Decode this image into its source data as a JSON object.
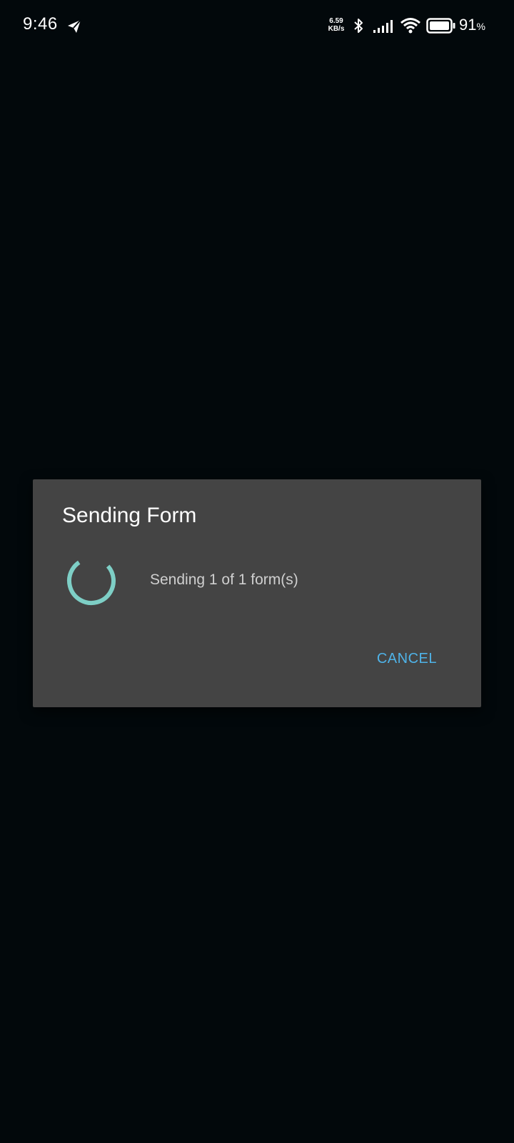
{
  "status_bar": {
    "time": "9:46",
    "net_speed_value": "6.59",
    "net_speed_unit": "KB/s",
    "battery_level": "91",
    "battery_unit": "%",
    "icons": [
      "telegram-icon",
      "bluetooth-icon",
      "signal-icon",
      "wifi-icon",
      "battery-icon"
    ]
  },
  "dialog": {
    "title": "Sending Form",
    "message": "Sending 1 of 1 form(s)",
    "cancel_label": "CANCEL",
    "spinner_color": "#7ecfc6",
    "accent_color": "#4fb3e8"
  }
}
